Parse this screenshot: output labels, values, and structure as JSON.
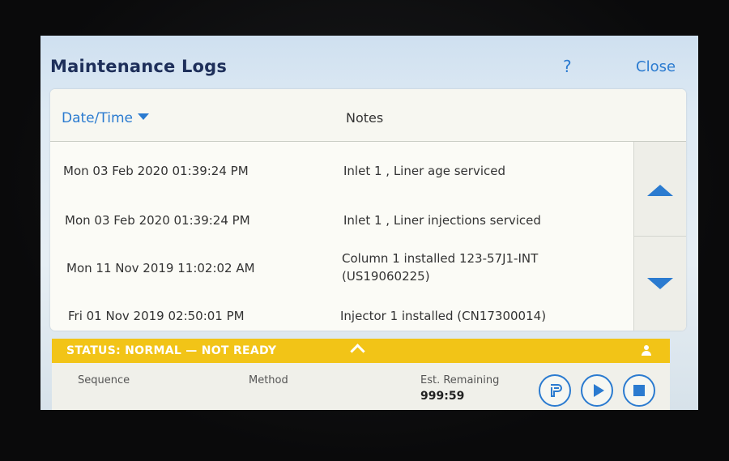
{
  "window": {
    "title": "Maintenance Logs",
    "help_label": "?",
    "close_label": "Close"
  },
  "table": {
    "columns": {
      "date": "Date/Time",
      "notes": "Notes"
    },
    "rows": [
      {
        "date": "Mon 03 Feb 2020 01:39:24 PM",
        "note": "Inlet 1 , Liner age serviced"
      },
      {
        "date": "Mon 03 Feb 2020 01:39:24 PM",
        "note": "Inlet 1 , Liner injections serviced"
      },
      {
        "date": "Mon 11 Nov 2019 11:02:02 AM",
        "note": "Column 1 installed 123-57J1-INT (US19060225)"
      },
      {
        "date": "Fri 01 Nov 2019 02:50:01 PM",
        "note": "Injector 1 installed (CN17300014)"
      }
    ]
  },
  "status": {
    "text": "STATUS: NORMAL — NOT READY",
    "color": "#f2c417"
  },
  "run": {
    "sequence_label": "Sequence",
    "method_label": "Method",
    "remaining_label": "Est. Remaining",
    "remaining_value": "999:59"
  },
  "icons": {
    "sort": "caret-down-icon",
    "scroll_up": "triangle-up-icon",
    "scroll_down": "triangle-down-icon",
    "status_expand": "chevron-up-icon",
    "user": "user-icon",
    "prerun": "prerun-icon",
    "play": "play-icon",
    "stop": "stop-icon"
  },
  "colors": {
    "accent": "#2b7bd0",
    "title": "#1e2f5a"
  }
}
